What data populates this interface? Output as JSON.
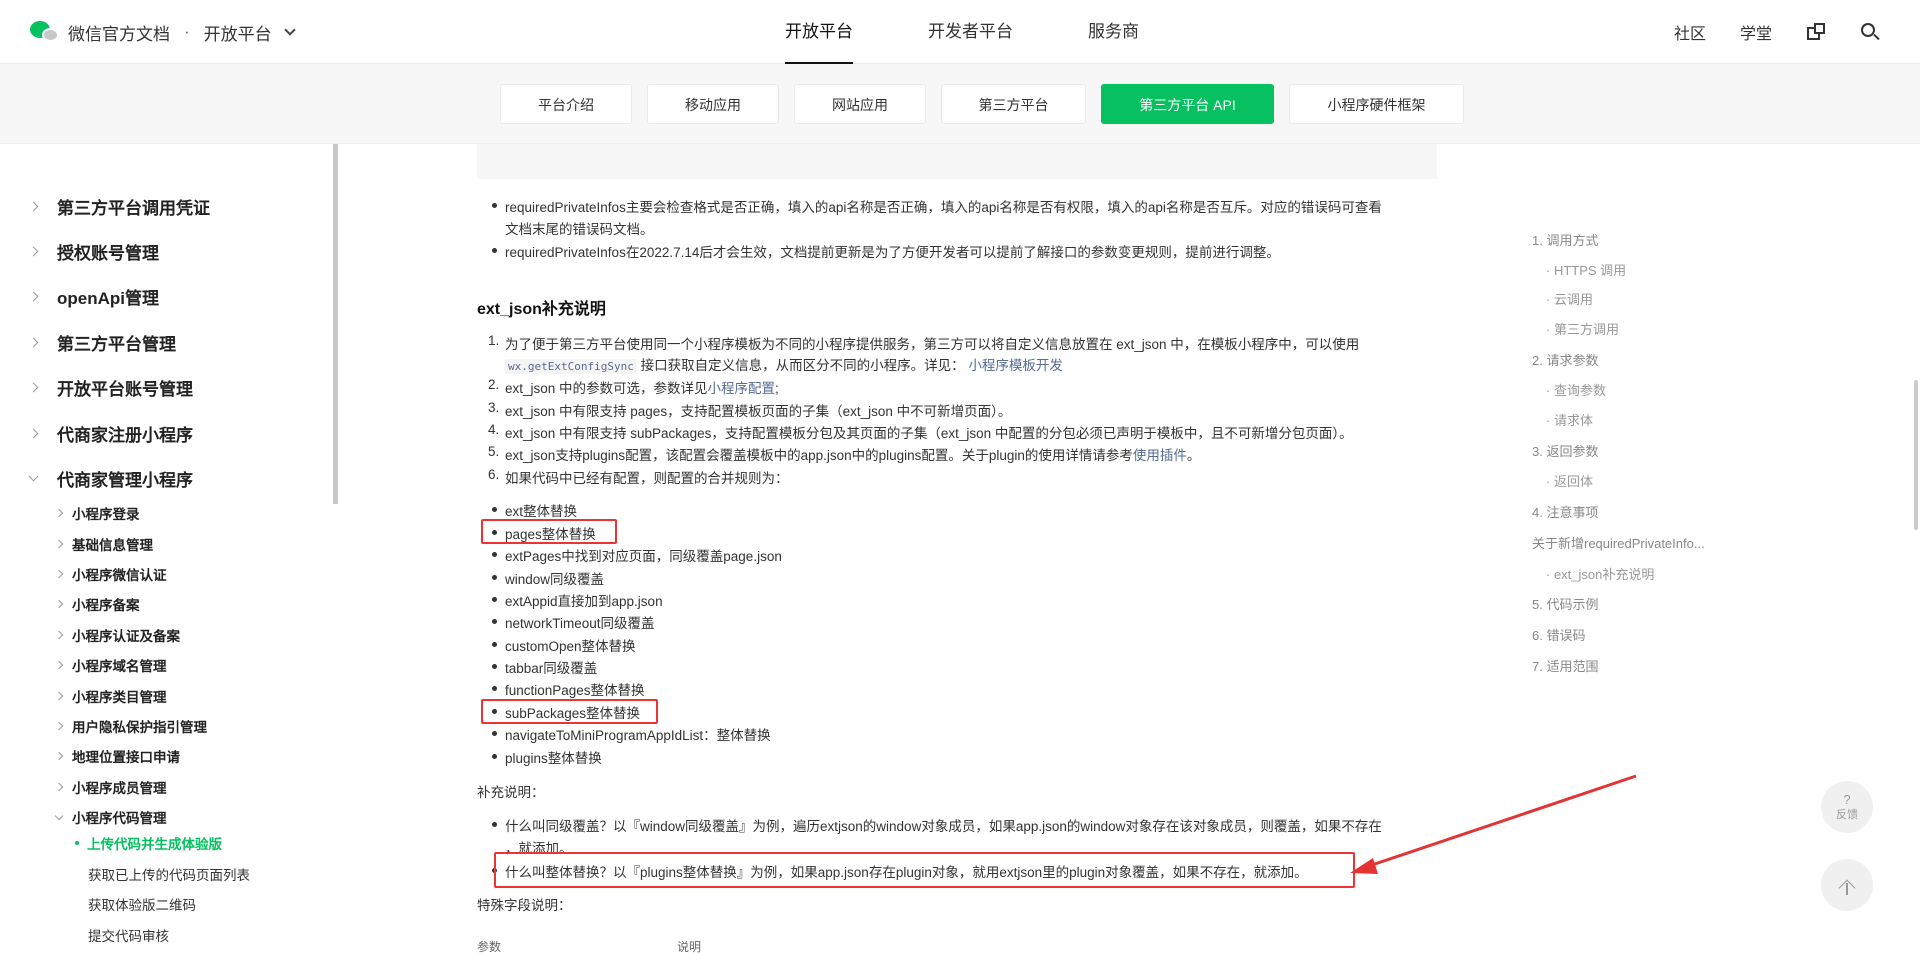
{
  "topbar": {
    "brand_title": "微信官方文档",
    "separator": "·",
    "platform_switch": "开放平台",
    "nav": [
      "开放平台",
      "开发者平台",
      "服务商"
    ],
    "active_nav_index": 0,
    "right": {
      "community": "社区",
      "academy": "学堂"
    }
  },
  "subnav": {
    "tabs": [
      "平台介绍",
      "移动应用",
      "网站应用",
      "第三方平台",
      "第三方平台 API",
      "小程序硬件框架"
    ],
    "active_index": 4
  },
  "sidebar": {
    "level1": [
      "第三方平台调用凭证",
      "授权账号管理",
      "openApi管理",
      "第三方平台管理",
      "开放平台账号管理",
      "代商家注册小程序",
      "代商家管理小程序"
    ],
    "level2": [
      "小程序登录",
      "基础信息管理",
      "小程序微信认证",
      "小程序备案",
      "小程序认证及备案",
      "小程序域名管理",
      "小程序类目管理",
      "用户隐私保护指引管理",
      "地理位置接口申请",
      "小程序成员管理",
      "小程序代码管理"
    ],
    "active_item": "上传代码并生成体验版",
    "level3": [
      "获取已上传的代码页面列表",
      "获取体验版二维码",
      "提交代码审核"
    ]
  },
  "content": {
    "notes": [
      "requiredPrivateInfos主要会检查格式是否正确，填入的api名称是否正确，填入的api名称是否有权限，填入的api名称是否互斥。对应的错误码可查看",
      "文档末尾的错误码文档。",
      "requiredPrivateInfos在2022.7.14后才会生效，文档提前更新是为了方便开发者可以提前了解接口的参数变更规则，提前进行调整。"
    ],
    "section_title": "ext_json补充说明",
    "ordered": {
      "i1_a": "为了便于第三方平台使用同一个小程序模板为不同的小程序提供服务，第三方可以将自定义信息放置在 ext_json 中，在模板小程序中，可以使用",
      "i1_code": "wx.getExtConfigSync",
      "i1_b": "接口获取自定义信息，从而区分不同的小程序。详见：",
      "i1_link": "小程序模板开发",
      "i2_a": "ext_json 中的参数可选，参数详见",
      "i2_link": "小程序配置",
      "i2_b": ";",
      "i3": "ext_json 中有限支持 pages，支持配置模板页面的子集（ext_json 中不可新增页面）。",
      "i4": "ext_json 中有限支持 subPackages，支持配置模板分包及其页面的子集（ext_json 中配置的分包必须已声明于模板中，且不可新增分包页面）。",
      "i5_a": "ext_json支持plugins配置，该配置会覆盖模板中的app.json中的plugins配置。关于plugin的使用详情请参考",
      "i5_link": "使用插件",
      "i5_b": "。",
      "i6": "如果代码中已经有配置，则配置的合并规则为："
    },
    "rules": [
      "ext整体替换",
      "pages整体替换",
      "extPages中找到对应页面，同级覆盖page.json",
      "window同级覆盖",
      "extAppid直接加到app.json",
      "networkTimeout同级覆盖",
      "customOpen整体替换",
      "tabbar同级覆盖",
      "functionPages整体替换",
      "subPackages整体替换",
      "navigateToMiniProgramAppIdList：整体替换",
      "plugins整体替换"
    ],
    "supplement_label": "补充说明：",
    "supplement": [
      "什么叫同级覆盖？以『window同级覆盖』为例，遍历extjson的window对象成员，如果app.json的window对象存在该对象成员，则覆盖，如果不存在",
      "，就添加。",
      "什么叫整体替换？以『plugins整体替换』为例，如果app.json存在plugin对象，就用extjson里的plugin对象覆盖，如果不存在，就添加。"
    ],
    "special_label": "特殊字段说明：",
    "table_headers": [
      "参数",
      "说明"
    ]
  },
  "toc": {
    "entries": [
      "1. 调用方式",
      "· HTTPS 调用",
      "· 云调用",
      "· 第三方调用",
      "2. 请求参数",
      "· 查询参数",
      "· 请求体",
      "3. 返回参数",
      "· 返回体",
      "4. 注意事项",
      "关于新增requiredPrivateInfo...",
      "· ext_json补充说明",
      "5. 代码示例",
      "6. 错误码",
      "7. 适用范围"
    ]
  },
  "fab": {
    "feedback_q": "?",
    "feedback_label": "反馈"
  },
  "colors": {
    "accent": "#07c160",
    "annotation": "#e33333",
    "link": "#576b95"
  }
}
